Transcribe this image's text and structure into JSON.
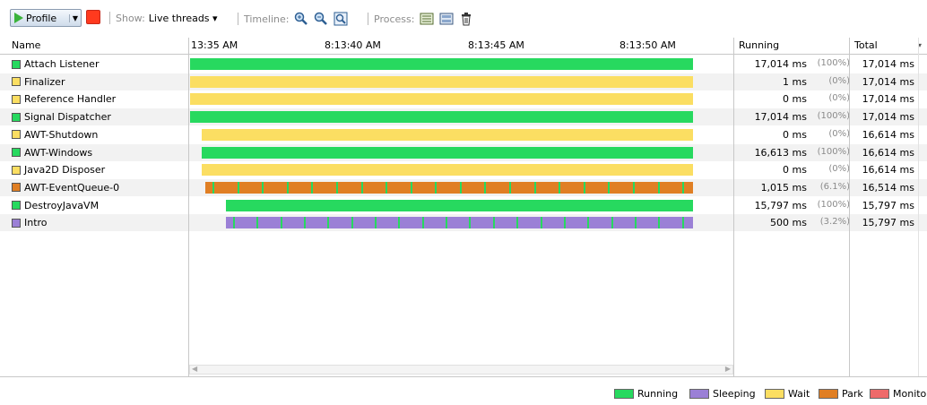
{
  "toolbar": {
    "profile_label": "Profile",
    "show_label": "Show:",
    "show_value": "Live threads",
    "timeline_label": "Timeline:",
    "process_label": "Process:"
  },
  "columns": {
    "name": "Name",
    "running": "Running",
    "total": "Total"
  },
  "timeline_ticks": [
    "13:35 AM",
    "8:13:40 AM",
    "8:13:45 AM",
    "8:13:50 AM"
  ],
  "colors": {
    "running": "#27d95f",
    "sleeping": "#9b80d6",
    "wait": "#fbde62",
    "park": "#e07f24",
    "monitor": "#ee6a6a"
  },
  "threads": [
    {
      "name": "Attach Listener",
      "state": "running",
      "running": "17,014 ms",
      "pct": "(100%)",
      "total": "17,014 ms",
      "start": 0.0
    },
    {
      "name": "Finalizer",
      "state": "wait",
      "running": "1 ms",
      "pct": "(0%)",
      "total": "17,014 ms",
      "start": 0.0
    },
    {
      "name": "Reference Handler",
      "state": "wait",
      "running": "0 ms",
      "pct": "(0%)",
      "total": "17,014 ms",
      "start": 0.0
    },
    {
      "name": "Signal Dispatcher",
      "state": "running",
      "running": "17,014 ms",
      "pct": "(100%)",
      "total": "17,014 ms",
      "start": 0.0
    },
    {
      "name": "AWT-Shutdown",
      "state": "wait",
      "running": "0 ms",
      "pct": "(0%)",
      "total": "16,614 ms",
      "start": 0.024
    },
    {
      "name": "AWT-Windows",
      "state": "running",
      "running": "16,613 ms",
      "pct": "(100%)",
      "total": "16,614 ms",
      "start": 0.024
    },
    {
      "name": "Java2D Disposer",
      "state": "wait",
      "running": "0 ms",
      "pct": "(0%)",
      "total": "16,614 ms",
      "start": 0.024
    },
    {
      "name": "AWT-EventQueue-0",
      "state": "park",
      "running": "1,015 ms",
      "pct": "(6.1%)",
      "total": "16,514 ms",
      "start": 0.03
    },
    {
      "name": "DestroyJavaVM",
      "state": "running",
      "running": "15,797 ms",
      "pct": "(100%)",
      "total": "15,797 ms",
      "start": 0.072
    },
    {
      "name": "Intro",
      "state": "sleeping",
      "running": "500 ms",
      "pct": "(3.2%)",
      "total": "15,797 ms",
      "start": 0.072
    }
  ],
  "legend": [
    {
      "key": "running",
      "label": "Running"
    },
    {
      "key": "sleeping",
      "label": "Sleeping"
    },
    {
      "key": "wait",
      "label": "Wait"
    },
    {
      "key": "park",
      "label": "Park"
    },
    {
      "key": "monitor",
      "label": "Monitor"
    }
  ]
}
